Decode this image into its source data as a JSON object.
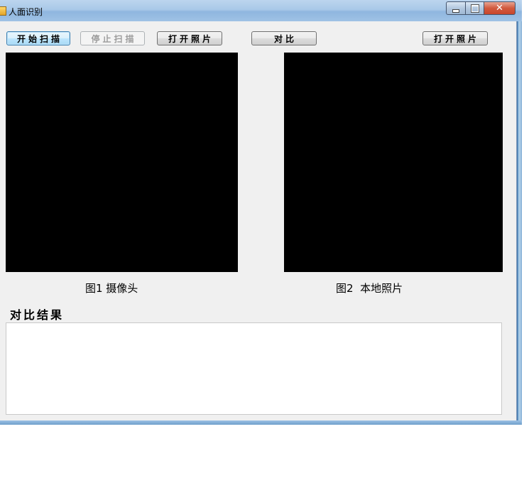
{
  "window": {
    "title": "人面识别"
  },
  "toolbar": {
    "start_scan_label": "开始扫描",
    "stop_scan_label": "停止扫描",
    "open_photo_left_label": "打开照片",
    "compare_label": "对比",
    "open_photo_right_label": "打开照片"
  },
  "panels": {
    "camera_caption": "图1 摄像头",
    "local_caption": "图2  本地照片"
  },
  "result": {
    "label": "对比结果",
    "text": ""
  },
  "icons": {
    "app": "app-icon",
    "minimize": "minimize-icon",
    "maximize": "maximize-icon",
    "close": "close-icon"
  }
}
